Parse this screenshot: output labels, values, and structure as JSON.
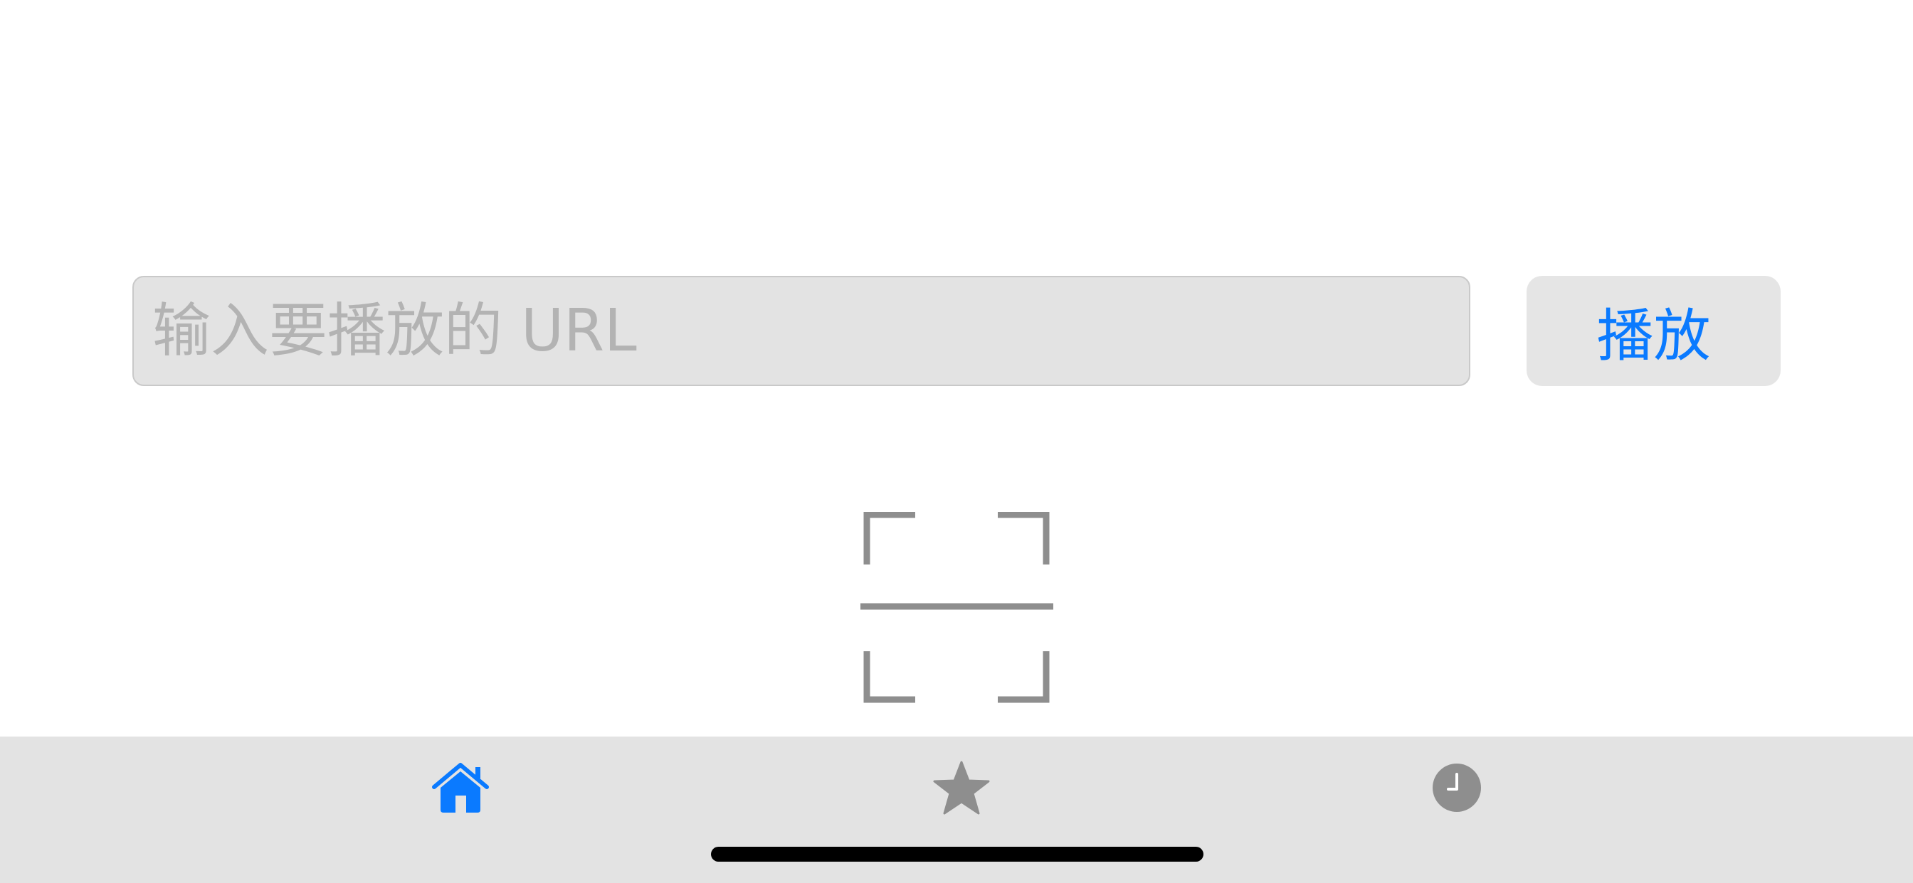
{
  "url_field": {
    "placeholder": "输入要播放的 URL",
    "value": ""
  },
  "play_button": {
    "label": "播放"
  },
  "scan_button": {
    "icon": "qr-scan-icon"
  },
  "tab_bar": {
    "tabs": [
      {
        "id": "home",
        "icon": "home-icon",
        "selected": true
      },
      {
        "id": "favorites",
        "icon": "star-icon",
        "selected": false
      },
      {
        "id": "history",
        "icon": "clock-icon",
        "selected": false
      }
    ]
  },
  "colors": {
    "accent": "#0a7aff",
    "inactive_icon": "#8e8e8e",
    "tab_bar_background": "#e3e3e3",
    "field_background": "#e3e3e3",
    "placeholder_text": "#b3b3b3"
  }
}
